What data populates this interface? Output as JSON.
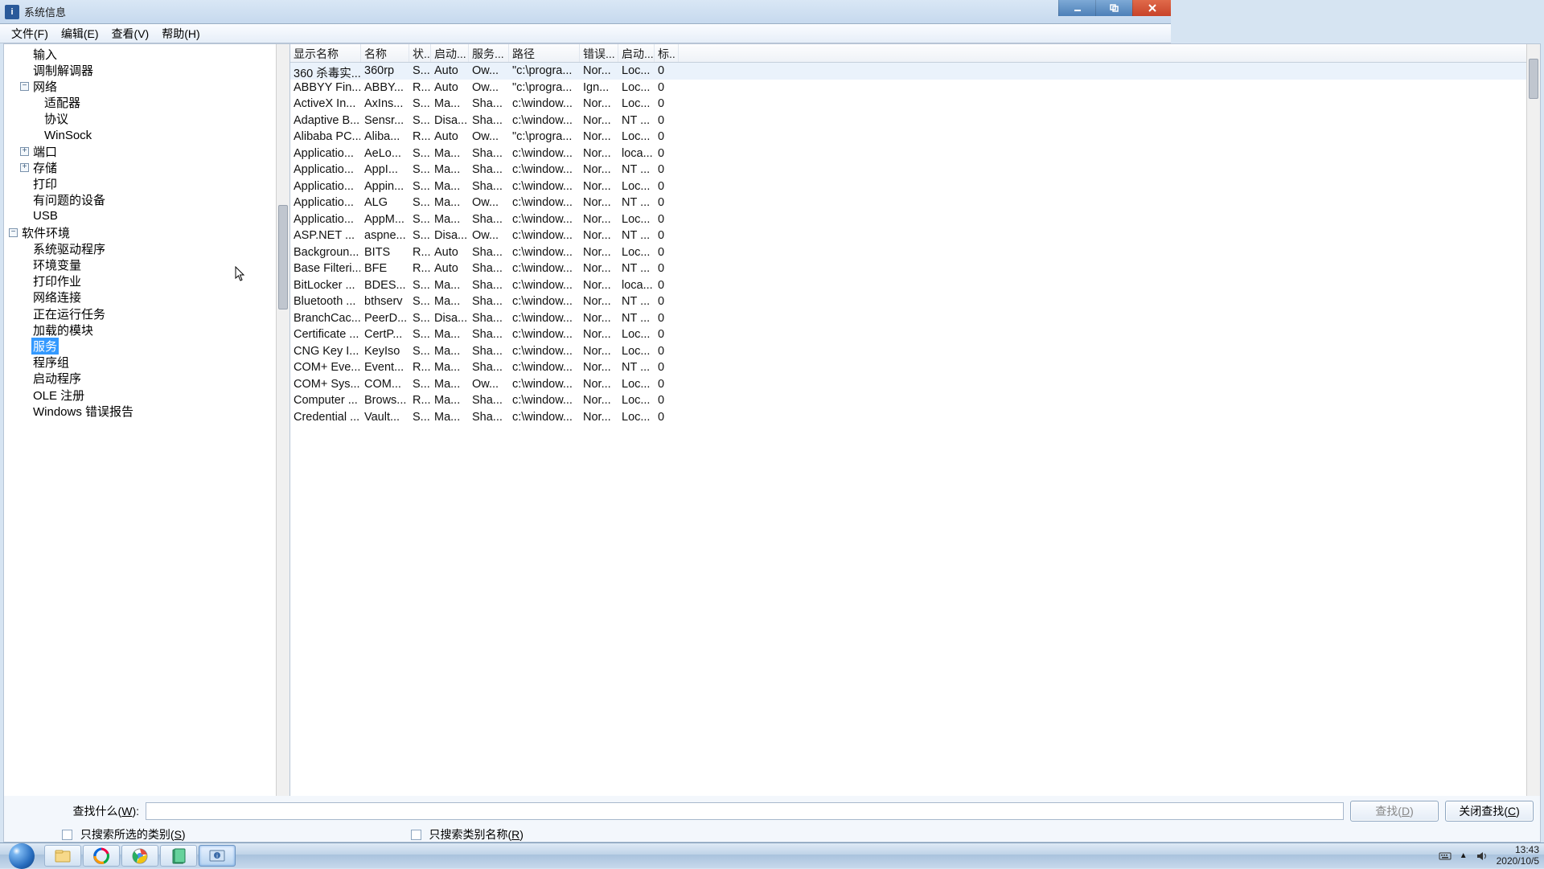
{
  "window": {
    "title": "系统信息"
  },
  "menu": {
    "file": "文件(F)",
    "edit": "编辑(E)",
    "view": "查看(V)",
    "help": "帮助(H)"
  },
  "tree": [
    {
      "depth": 1,
      "toggle": "",
      "label": "输入"
    },
    {
      "depth": 1,
      "toggle": "",
      "label": "调制解调器"
    },
    {
      "depth": 1,
      "toggle": "-",
      "label": "网络"
    },
    {
      "depth": 2,
      "toggle": "",
      "label": "适配器"
    },
    {
      "depth": 2,
      "toggle": "",
      "label": "协议"
    },
    {
      "depth": 2,
      "toggle": "",
      "label": "WinSock"
    },
    {
      "depth": 1,
      "toggle": "+",
      "label": "端口"
    },
    {
      "depth": 1,
      "toggle": "+",
      "label": "存储"
    },
    {
      "depth": 1,
      "toggle": "",
      "label": "打印"
    },
    {
      "depth": 1,
      "toggle": "",
      "label": "有问题的设备"
    },
    {
      "depth": 1,
      "toggle": "",
      "label": "USB"
    },
    {
      "depth": 0,
      "toggle": "-",
      "label": "软件环境"
    },
    {
      "depth": 1,
      "toggle": "",
      "label": "系统驱动程序"
    },
    {
      "depth": 1,
      "toggle": "",
      "label": "环境变量"
    },
    {
      "depth": 1,
      "toggle": "",
      "label": "打印作业"
    },
    {
      "depth": 1,
      "toggle": "",
      "label": "网络连接"
    },
    {
      "depth": 1,
      "toggle": "",
      "label": "正在运行任务"
    },
    {
      "depth": 1,
      "toggle": "",
      "label": "加载的模块"
    },
    {
      "depth": 1,
      "toggle": "",
      "label": "服务",
      "selected": true
    },
    {
      "depth": 1,
      "toggle": "",
      "label": "程序组"
    },
    {
      "depth": 1,
      "toggle": "",
      "label": "启动程序"
    },
    {
      "depth": 1,
      "toggle": "",
      "label": "OLE 注册"
    },
    {
      "depth": 1,
      "toggle": "",
      "label": "Windows 错误报告"
    }
  ],
  "columns": [
    "显示名称",
    "名称",
    "状...",
    "启动...",
    "服务...",
    "路径",
    "错误...",
    "启动...",
    "标.."
  ],
  "rows": [
    [
      "360 杀毒实...",
      "360rp",
      "S...",
      "Auto",
      "Ow...",
      "\"c:\\progra...",
      "Nor...",
      "Loc...",
      "0"
    ],
    [
      "ABBYY Fin...",
      "ABBY...",
      "R...",
      "Auto",
      "Ow...",
      "\"c:\\progra...",
      "Ign...",
      "Loc...",
      "0"
    ],
    [
      "ActiveX In...",
      "AxIns...",
      "S...",
      "Ma...",
      "Sha...",
      "c:\\window...",
      "Nor...",
      "Loc...",
      "0"
    ],
    [
      "Adaptive B...",
      "Sensr...",
      "S...",
      "Disa...",
      "Sha...",
      "c:\\window...",
      "Nor...",
      "NT ...",
      "0"
    ],
    [
      "Alibaba PC...",
      "Aliba...",
      "R...",
      "Auto",
      "Ow...",
      "\"c:\\progra...",
      "Nor...",
      "Loc...",
      "0"
    ],
    [
      "Applicatio...",
      "AeLo...",
      "S...",
      "Ma...",
      "Sha...",
      "c:\\window...",
      "Nor...",
      "loca...",
      "0"
    ],
    [
      "Applicatio...",
      "AppI...",
      "S...",
      "Ma...",
      "Sha...",
      "c:\\window...",
      "Nor...",
      "NT ...",
      "0"
    ],
    [
      "Applicatio...",
      "Appin...",
      "S...",
      "Ma...",
      "Sha...",
      "c:\\window...",
      "Nor...",
      "Loc...",
      "0"
    ],
    [
      "Applicatio...",
      "ALG",
      "S...",
      "Ma...",
      "Ow...",
      "c:\\window...",
      "Nor...",
      "NT ...",
      "0"
    ],
    [
      "Applicatio...",
      "AppM...",
      "S...",
      "Ma...",
      "Sha...",
      "c:\\window...",
      "Nor...",
      "Loc...",
      "0"
    ],
    [
      "ASP.NET ...",
      "aspne...",
      "S...",
      "Disa...",
      "Ow...",
      "c:\\window...",
      "Nor...",
      "NT ...",
      "0"
    ],
    [
      "Backgroun...",
      "BITS",
      "R...",
      "Auto",
      "Sha...",
      "c:\\window...",
      "Nor...",
      "Loc...",
      "0"
    ],
    [
      "Base Filteri...",
      "BFE",
      "R...",
      "Auto",
      "Sha...",
      "c:\\window...",
      "Nor...",
      "NT ...",
      "0"
    ],
    [
      "BitLocker ...",
      "BDES...",
      "S...",
      "Ma...",
      "Sha...",
      "c:\\window...",
      "Nor...",
      "loca...",
      "0"
    ],
    [
      "Bluetooth ...",
      "bthserv",
      "S...",
      "Ma...",
      "Sha...",
      "c:\\window...",
      "Nor...",
      "NT ...",
      "0"
    ],
    [
      "BranchCac...",
      "PeerD...",
      "S...",
      "Disa...",
      "Sha...",
      "c:\\window...",
      "Nor...",
      "NT ...",
      "0"
    ],
    [
      "Certificate ...",
      "CertP...",
      "S...",
      "Ma...",
      "Sha...",
      "c:\\window...",
      "Nor...",
      "Loc...",
      "0"
    ],
    [
      "CNG Key I...",
      "KeyIso",
      "S...",
      "Ma...",
      "Sha...",
      "c:\\window...",
      "Nor...",
      "Loc...",
      "0"
    ],
    [
      "COM+ Eve...",
      "Event...",
      "R...",
      "Ma...",
      "Sha...",
      "c:\\window...",
      "Nor...",
      "NT ...",
      "0"
    ],
    [
      "COM+ Sys...",
      "COM...",
      "S...",
      "Ma...",
      "Ow...",
      "c:\\window...",
      "Nor...",
      "Loc...",
      "0"
    ],
    [
      "Computer ...",
      "Brows...",
      "R...",
      "Ma...",
      "Sha...",
      "c:\\window...",
      "Nor...",
      "Loc...",
      "0"
    ],
    [
      "Credential ...",
      "Vault...",
      "S...",
      "Ma...",
      "Sha...",
      "c:\\window...",
      "Nor...",
      "Loc...",
      "0"
    ]
  ],
  "search": {
    "label": "查找什么(",
    "label_u": "W",
    "label_post": "):",
    "value": "",
    "find_btn": "查找(",
    "find_btn_u": "D",
    "find_btn_post": ")",
    "close_btn": "关闭查找(",
    "close_btn_u": "C",
    "close_btn_post": ")",
    "opt1": "只搜索所选的类别(",
    "opt1_u": "S",
    "opt1_post": ")",
    "opt2": "只搜索类别名称(",
    "opt2_u": "R",
    "opt2_post": ")"
  },
  "taskbar": {
    "time": "13:43",
    "date": "2020/10/5"
  }
}
